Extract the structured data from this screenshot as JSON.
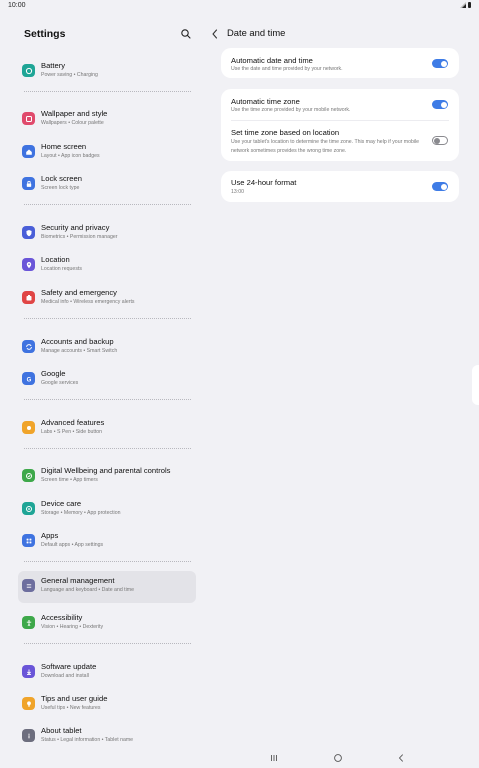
{
  "status_bar": {
    "time": "10:00"
  },
  "left": {
    "title": "Settings",
    "items": [
      {
        "title": "Battery",
        "subtitle": "Power saving  •  Charging",
        "icon": "battery-icon",
        "color": "#1fa596"
      },
      {
        "title": "Wallpaper and style",
        "subtitle": "Wallpapers  •  Colour palette",
        "icon": "palette-icon",
        "color": "#e04a6c"
      },
      {
        "title": "Home screen",
        "subtitle": "Layout  •  App icon badges",
        "icon": "home-icon",
        "color": "#3f73e0"
      },
      {
        "title": "Lock screen",
        "subtitle": "Screen lock type",
        "icon": "lock-icon",
        "color": "#3f73e0"
      },
      {
        "title": "Security and privacy",
        "subtitle": "Biometrics  •  Permission manager",
        "icon": "shield-icon",
        "color": "#4a5fd8"
      },
      {
        "title": "Location",
        "subtitle": "Location requests",
        "icon": "location-icon",
        "color": "#6a55d8"
      },
      {
        "title": "Safety and emergency",
        "subtitle": "Medical info  •  Wireless emergency alerts",
        "icon": "emergency-icon",
        "color": "#e04545"
      },
      {
        "title": "Accounts and backup",
        "subtitle": "Manage accounts  •  Smart Switch",
        "icon": "sync-icon",
        "color": "#3f73e0"
      },
      {
        "title": "Google",
        "subtitle": "Google services",
        "icon": "google-icon",
        "color": "#3f73e0"
      },
      {
        "title": "Advanced features",
        "subtitle": "Labs  •  S Pen  •  Side button",
        "icon": "star-gear-icon",
        "color": "#f0a42a"
      },
      {
        "title": "Digital Wellbeing and parental controls",
        "subtitle": "Screen time  •  App timers",
        "icon": "wellbeing-icon",
        "color": "#3ea84a"
      },
      {
        "title": "Device care",
        "subtitle": "Storage  •  Memory  •  App protection",
        "icon": "device-care-icon",
        "color": "#1fa596"
      },
      {
        "title": "Apps",
        "subtitle": "Default apps  •  App settings",
        "icon": "apps-grid-icon",
        "color": "#3f73e0"
      },
      {
        "title": "General management",
        "subtitle": "Language and keyboard  •  Date and time",
        "icon": "sliders-icon",
        "color": "#6d6e9e"
      },
      {
        "title": "Accessibility",
        "subtitle": "Vision  •  Hearing  •  Dexterity",
        "icon": "accessibility-icon",
        "color": "#3ea84a"
      },
      {
        "title": "Software update",
        "subtitle": "Download and install",
        "icon": "update-icon",
        "color": "#6a55d8"
      },
      {
        "title": "Tips and user guide",
        "subtitle": "Useful tips  •  New features",
        "icon": "bulb-icon",
        "color": "#f0a42a"
      },
      {
        "title": "About tablet",
        "subtitle": "Status  •  Legal information  •  Tablet name",
        "icon": "info-icon",
        "color": "#6d6e7e"
      }
    ]
  },
  "right": {
    "title": "Date and time",
    "rows": [
      {
        "title": "Automatic date and time",
        "subtitle": "Use the date and time provided by your network.",
        "enabled": true
      },
      {
        "title": "Automatic time zone",
        "subtitle": "Use the time zone provided by your mobile network.",
        "enabled": true
      },
      {
        "title": "Set time zone based on location",
        "subtitle": "Use your tablet's location to determine the time zone. This may help if your mobile network sometimes provides the wrong time zone.",
        "enabled": false
      },
      {
        "title": "Use 24-hour format",
        "subtitle": "13:00",
        "enabled": true
      }
    ]
  },
  "colors": {
    "accent": "#3e7ce6",
    "selected_bg": "#e3e3e8",
    "background": "#f1f1f5"
  }
}
